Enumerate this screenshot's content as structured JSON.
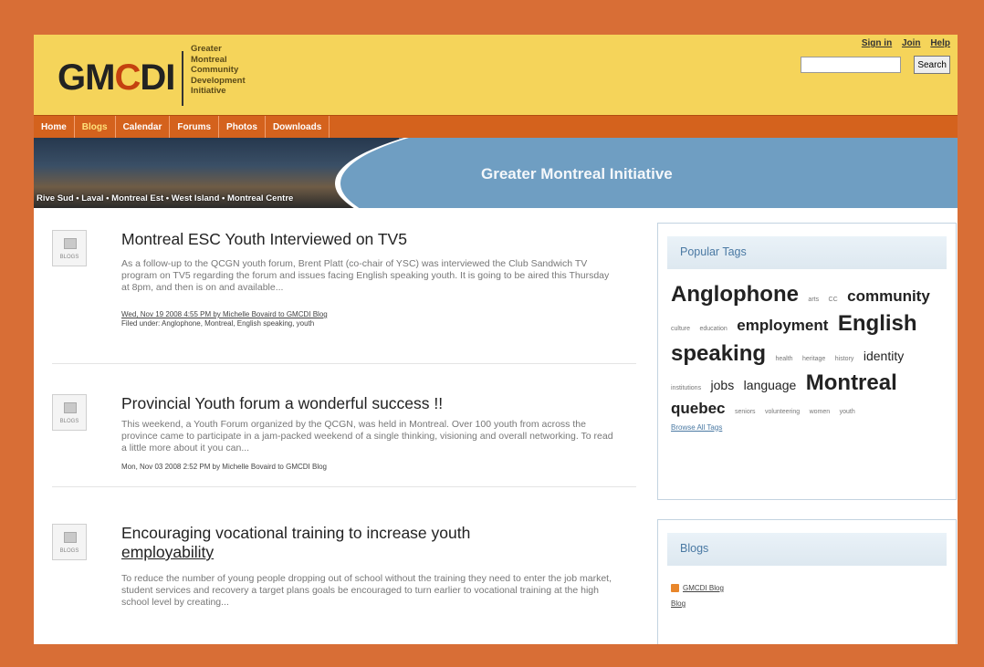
{
  "header": {
    "logo_a": "GM",
    "logo_b": "C",
    "logo_c": "DI",
    "tagline": [
      "Greater",
      "Montreal",
      "Community",
      "Development",
      "Initiative"
    ],
    "toplinks": [
      "Sign in",
      "Join",
      "Help"
    ],
    "search_placeholder": "",
    "search_button": "Search"
  },
  "nav": [
    "Home",
    "Blogs",
    "Calendar",
    "Forums",
    "Photos",
    "Downloads"
  ],
  "banner": {
    "title": "Greater Montreal Initiative",
    "links": "Rive Sud • Laval • Montreal Est • West Island • Montreal Centre"
  },
  "posts": [
    {
      "title": "Montreal ESC Youth Interviewed on TV5",
      "body": "As a follow-up to the QCGN youth forum, Brent Platt (co-chair of YSC) was interviewed the Club Sandwich TV program on TV5 regarding the forum and issues facing English speaking youth. It is going to be aired this Thursday at 8pm, and then is on and available...",
      "meta_line1": "Wed, Nov 19 2008 4:55 PM by Michelle Bovaird to GMCDI Blog",
      "meta_line2": "Filed under: Anglophone, Montreal, English speaking, youth",
      "icon_caption": "BLOGS"
    },
    {
      "title": "Provincial Youth forum a wonderful success !!",
      "body": "This weekend, a Youth Forum organized by the QCGN, was held in Montreal. Over 100 youth from across the province came to participate in a jam-packed weekend of a single thinking, visioning and overall networking. To read a little more about it you can...",
      "meta_line1": "Mon, Nov 03 2008 2:52 PM by Michelle Bovaird to GMCDI Blog",
      "icon_caption": "BLOGS"
    },
    {
      "title": "Encouraging vocational training to increase youth employability",
      "title_line1": "Encouraging vocational training to increase youth",
      "title_line2": "employability",
      "body": "To reduce the number of young people dropping out of school without the training they need to enter the job market, student services and recovery a target plans goals be encouraged to turn earlier to vocational training at the high school level by creating...",
      "icon_caption": "BLOGS"
    }
  ],
  "sidebar": {
    "tags_title": "Popular Tags",
    "tags": [
      {
        "text": "Anglophone",
        "size": "xl"
      },
      {
        "text": "arts",
        "size": "s"
      },
      {
        "text": "CC",
        "size": "s"
      },
      {
        "text": "community",
        "size": "lb"
      },
      {
        "text": "culture",
        "size": "s"
      },
      {
        "text": "education",
        "size": "s"
      },
      {
        "text": "employment",
        "size": "lb"
      },
      {
        "text": "English",
        "size": "xl"
      },
      {
        "text": "speaking",
        "size": "xl"
      },
      {
        "text": "health",
        "size": "s"
      },
      {
        "text": "heritage",
        "size": "s"
      },
      {
        "text": "history",
        "size": "s"
      },
      {
        "text": "identity",
        "size": "m"
      },
      {
        "text": "institutions",
        "size": "s"
      },
      {
        "text": "jobs",
        "size": "m"
      },
      {
        "text": "language",
        "size": "m"
      },
      {
        "text": "Montreal",
        "size": "xl"
      },
      {
        "text": "quebec",
        "size": "lb"
      },
      {
        "text": "seniors",
        "size": "s"
      },
      {
        "text": "volunteering",
        "size": "s"
      },
      {
        "text": "women",
        "size": "s"
      },
      {
        "text": "youth",
        "size": "s"
      }
    ],
    "more_tags": "Browse All Tags",
    "blogs_title": "Blogs",
    "blog_items": [
      "GMCDI Blog",
      "Blog"
    ]
  }
}
